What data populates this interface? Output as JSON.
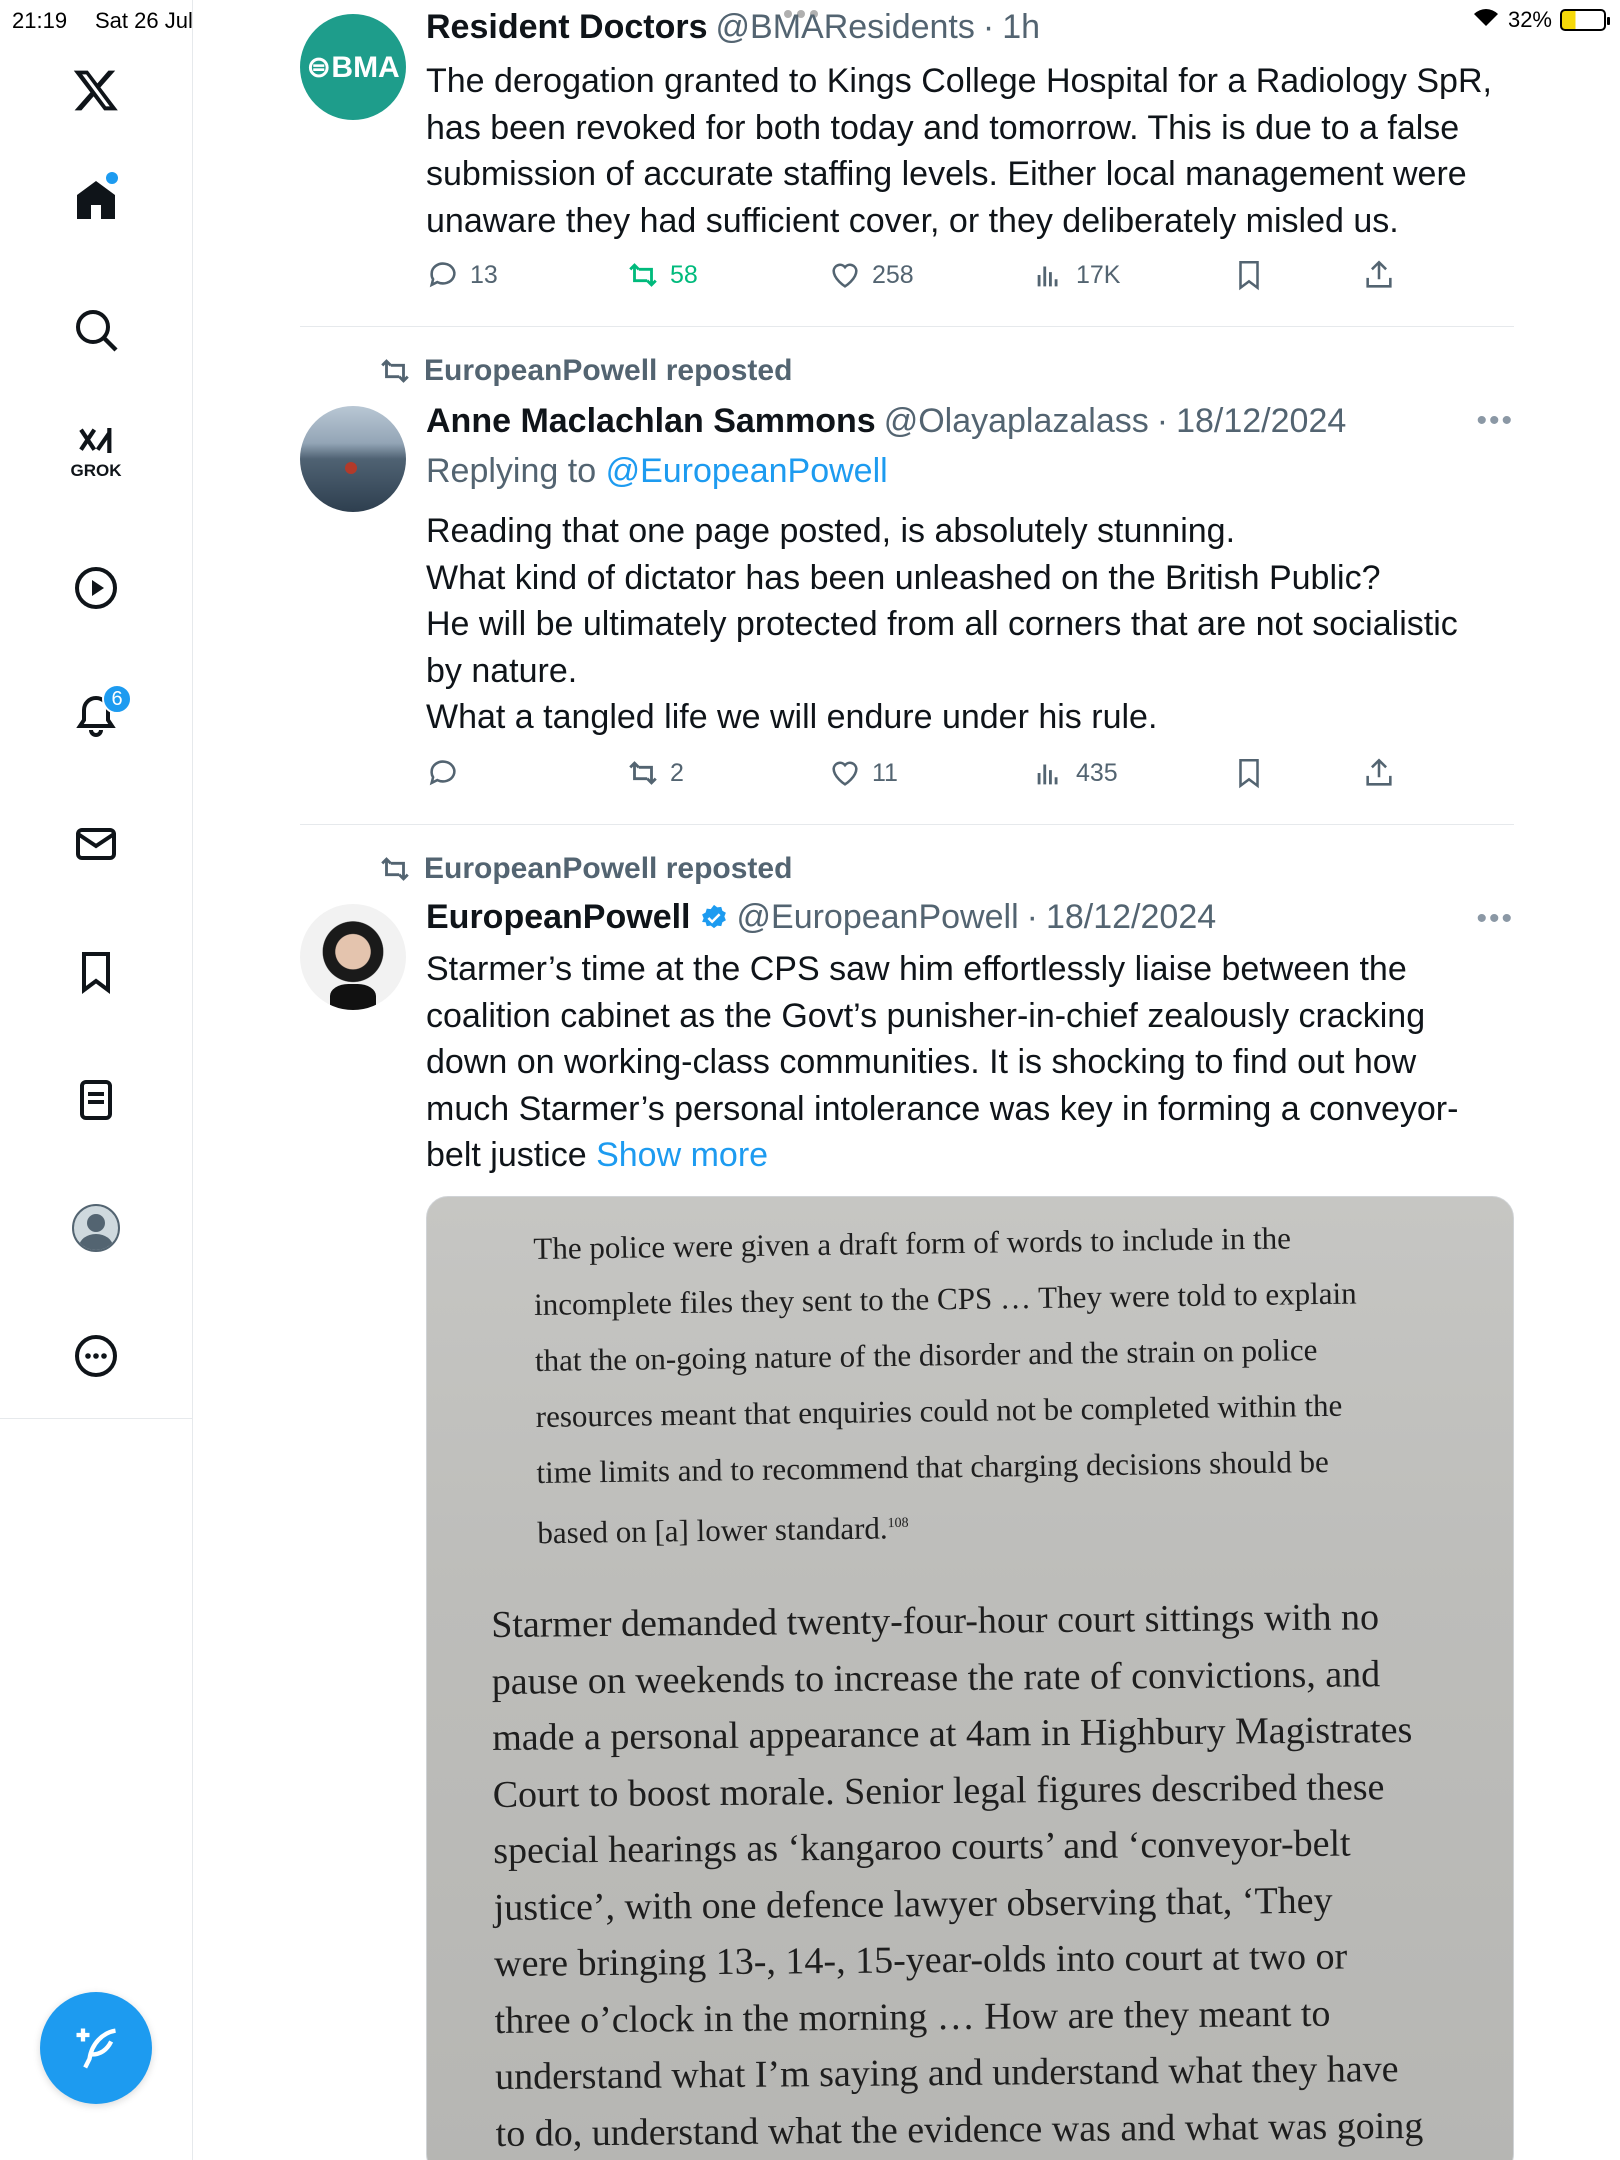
{
  "status_bar": {
    "time": "21:19",
    "date": "Sat 26 Jul",
    "battery": "32%"
  },
  "sidebar": {
    "grok_label": "GROK",
    "notifications_count": "6"
  },
  "tweets": [
    {
      "name": "Resident Doctors",
      "handle": "@BMAResidents",
      "sep": "·",
      "time": "1h",
      "avatar_text": "⊜BMA",
      "lines": [
        "The derogation granted to Kings College Hospital for a Radiology SpR,",
        "has been revoked for both today and tomorrow. This is due to a false",
        "submission of accurate staffing levels. Either local management were",
        "unaware they had sufficient cover, or they deliberately misled us."
      ],
      "replies": "13",
      "reposts": "58",
      "likes": "258",
      "views": "17K"
    },
    {
      "repost_label": "EuropeanPowell reposted",
      "name": "Anne Maclachlan Sammons",
      "handle": "@Olayaplazalass",
      "sep": "·",
      "time": "18/12/2024",
      "replying_prefix": "Replying to",
      "replying_to": "@EuropeanPowell",
      "lines": [
        "Reading that one page posted, is absolutely stunning.",
        "What kind of dictator has been unleashed on the British Public?",
        "He will be ultimately protected from all corners that are not socialistic",
        "by nature.",
        "What a tangled life we will endure under his rule."
      ],
      "replies": "",
      "reposts": "2",
      "likes": "11",
      "views": "435"
    },
    {
      "repost_label": "EuropeanPowell reposted",
      "name": "EuropeanPowell",
      "handle": "@EuropeanPowell",
      "sep": "·",
      "time": "18/12/2024",
      "lines": [
        "Starmer’s time at the CPS saw him effortlessly liaise between the",
        "coalition cabinet as the Govt’s punisher-in-chief zealously cracking",
        "down on working-class communities. It is shocking to find out how",
        "much Starmer’s personal intolerance was key in forming a conveyor-"
      ],
      "last_line": "belt justice",
      "show_more": "Show more",
      "photo": {
        "quote_lines": [
          "The police were given a draft form of words to include in the",
          "incomplete files they sent to the CPS … They were told to explain",
          "that the on-going nature of the disorder and the strain on police",
          "resources meant that enquiries could not be completed within the",
          "time limits and to recommend that charging decisions should be"
        ],
        "quote_last": "based on [a] lower standard.",
        "footnote": "108",
        "main_lines": [
          "Starmer demanded twenty-four-hour court sittings with no",
          "pause on weekends to increase the rate of convictions, and",
          "made a personal appearance at 4am in Highbury Magistrates",
          "Court to boost morale. Senior legal figures described these",
          "special hearings as ‘kangaroo courts’ and ‘conveyor-belt",
          "justice’, with one defence lawyer observing that, ‘They",
          "were bringing 13-, 14-, 15-year-olds into court at two or",
          "three o’clock in the morning … How are they meant to",
          "understand what I’m saying and understand what they have",
          "to do, understand what the evidence was and what was going"
        ]
      }
    }
  ]
}
